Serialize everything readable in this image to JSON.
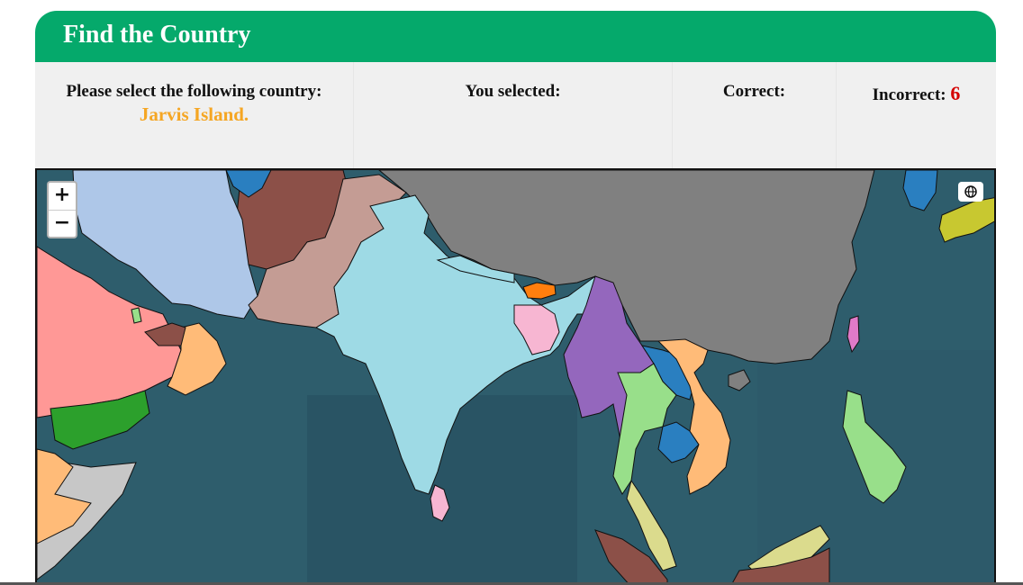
{
  "header": {
    "title": "Find the Country"
  },
  "info": {
    "prompt_label": "Please select the following country:",
    "target_country": "Jarvis Island.",
    "selected_label": "You selected:",
    "selected_value": "",
    "correct_label": "Correct:",
    "correct_value": "",
    "incorrect_label": "Incorrect:",
    "incorrect_value": "6"
  },
  "map": {
    "zoom_in_label": "+",
    "zoom_out_label": "−",
    "layers_icon": "globe-icon",
    "ocean_color": "#2f5f6e"
  }
}
